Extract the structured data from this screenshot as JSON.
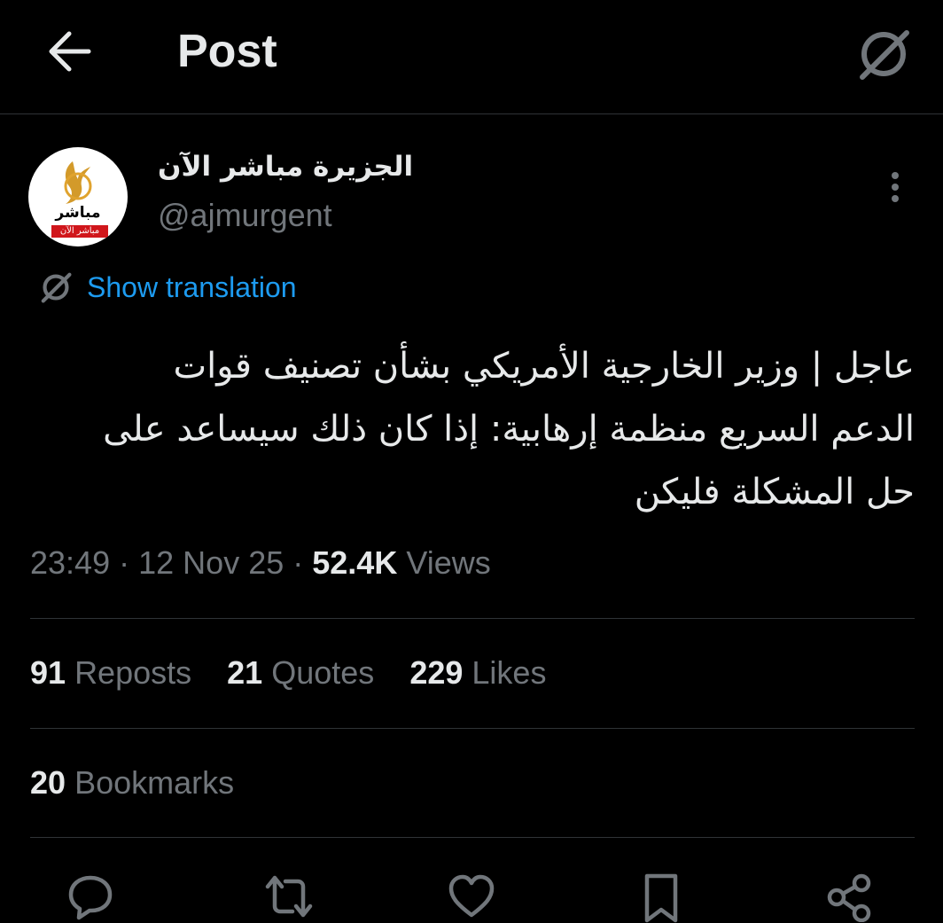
{
  "header": {
    "back_icon": "arrow-left-icon",
    "title": "Post",
    "translate_icon": "translate-globe-icon"
  },
  "author": {
    "display_name": "الجزيرة مباشر الآن",
    "handle": "@ajmurgent",
    "avatar_logo_text": "مباشر",
    "avatar_strip_text": "مباشر الآن",
    "more_icon": "more-vertical-icon"
  },
  "translation": {
    "icon": "translate-globe-icon",
    "label": "Show translation",
    "color": "#1d9bf0"
  },
  "post": {
    "lines": [
      "عاجل | وزير الخارجية الأمريكي بشأن تصنيف قوات",
      "الدعم السريع منظمة إرهابية: إذا كان ذلك سيساعد على",
      "حل المشكلة فليكن"
    ]
  },
  "meta": {
    "time": "23:49",
    "separator": "·",
    "date": "12 Nov 25",
    "views_count": "52.4K",
    "views_label": "Views"
  },
  "stats": {
    "reposts": {
      "count": "91",
      "label": "Reposts"
    },
    "quotes": {
      "count": "21",
      "label": "Quotes"
    },
    "likes": {
      "count": "229",
      "label": "Likes"
    },
    "bookmarks": {
      "count": "20",
      "label": "Bookmarks"
    }
  },
  "actions": {
    "reply_icon": "reply-icon",
    "repost_icon": "repost-icon",
    "like_icon": "heart-icon",
    "bookmark_icon": "bookmark-icon",
    "share_icon": "share-icon"
  },
  "colors": {
    "background": "#000000",
    "text_primary": "#e7e9ea",
    "text_secondary": "#71767b",
    "divider": "#2f3336",
    "accent": "#1d9bf0"
  }
}
